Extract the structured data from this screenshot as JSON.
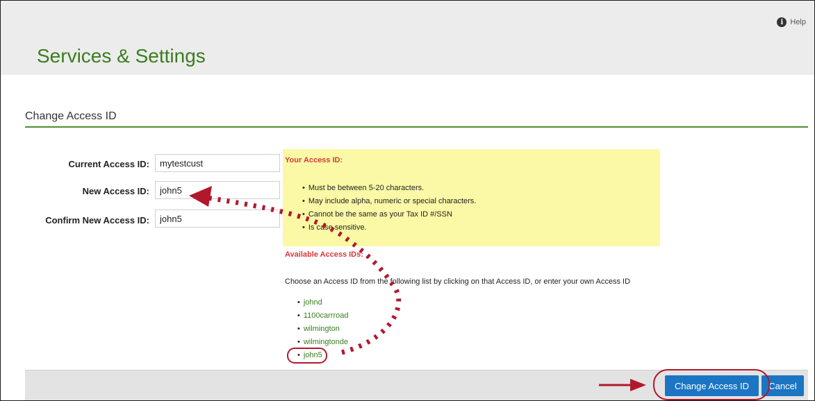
{
  "header": {
    "help_label": "Help",
    "help_icon": "info-icon",
    "title": "Services & Settings"
  },
  "section": {
    "title": "Change Access ID"
  },
  "form": {
    "current_label": "Current Access ID:",
    "current_value": "mytestcust",
    "new_label": "New Access ID:",
    "new_value": "john5",
    "confirm_label": "Confirm New Access ID:",
    "confirm_value": "john5"
  },
  "info": {
    "title": "Your Access ID:",
    "rules": [
      "Must be between 5-20 characters.",
      "May include alpha, numeric or special characters.",
      "Cannot be the same as your Tax ID #/SSN",
      "Is case sensitive."
    ]
  },
  "available": {
    "title": "Available Access IDs:",
    "description": "Choose an Access ID from the following list by clicking on that Access ID, or enter your own Access ID",
    "ids": [
      "johnd",
      "1100carrroad",
      "wilmington",
      "wilmingtonde",
      "john5"
    ]
  },
  "buttons": {
    "change": "Change Access ID",
    "cancel": "Cancel"
  },
  "colors": {
    "title_green": "#3a7d1e",
    "accent_red": "#d53a3a",
    "button_blue": "#1b75c3",
    "info_yellow": "#fbf8a6",
    "annotation_red": "#b2182b"
  }
}
